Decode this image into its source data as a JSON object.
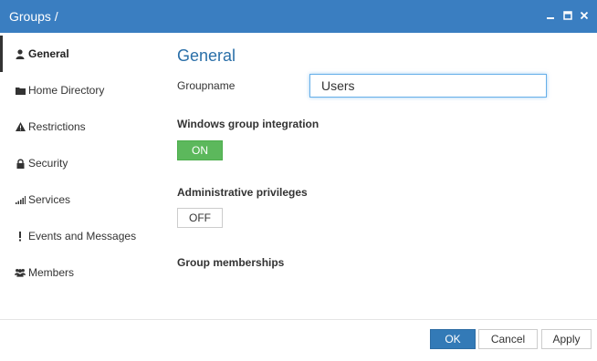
{
  "window": {
    "title": "Groups /"
  },
  "sidebar": {
    "items": [
      {
        "label": "General",
        "icon": "user-icon",
        "active": true
      },
      {
        "label": "Home Directory",
        "icon": "folder-icon",
        "active": false
      },
      {
        "label": "Restrictions",
        "icon": "warning-icon",
        "active": false
      },
      {
        "label": "Security",
        "icon": "lock-icon",
        "active": false
      },
      {
        "label": "Services",
        "icon": "signal-icon",
        "active": false
      },
      {
        "label": "Events and Messages",
        "icon": "exclamation-icon",
        "active": false
      },
      {
        "label": "Members",
        "icon": "users-icon",
        "active": false
      }
    ]
  },
  "main": {
    "heading": "General",
    "groupname": {
      "label": "Groupname",
      "value": "Users"
    },
    "windows_integration": {
      "label": "Windows group integration",
      "toggle": "ON"
    },
    "admin_privileges": {
      "label": "Administrative privileges",
      "toggle": "OFF"
    },
    "group_memberships": {
      "label": "Group memberships"
    }
  },
  "footer": {
    "ok": "OK",
    "cancel": "Cancel",
    "apply": "Apply"
  },
  "colors": {
    "titlebar": "#3a7ec1",
    "heading": "#2a6fa8",
    "on": "#5cb85c",
    "primary": "#337ab7"
  }
}
